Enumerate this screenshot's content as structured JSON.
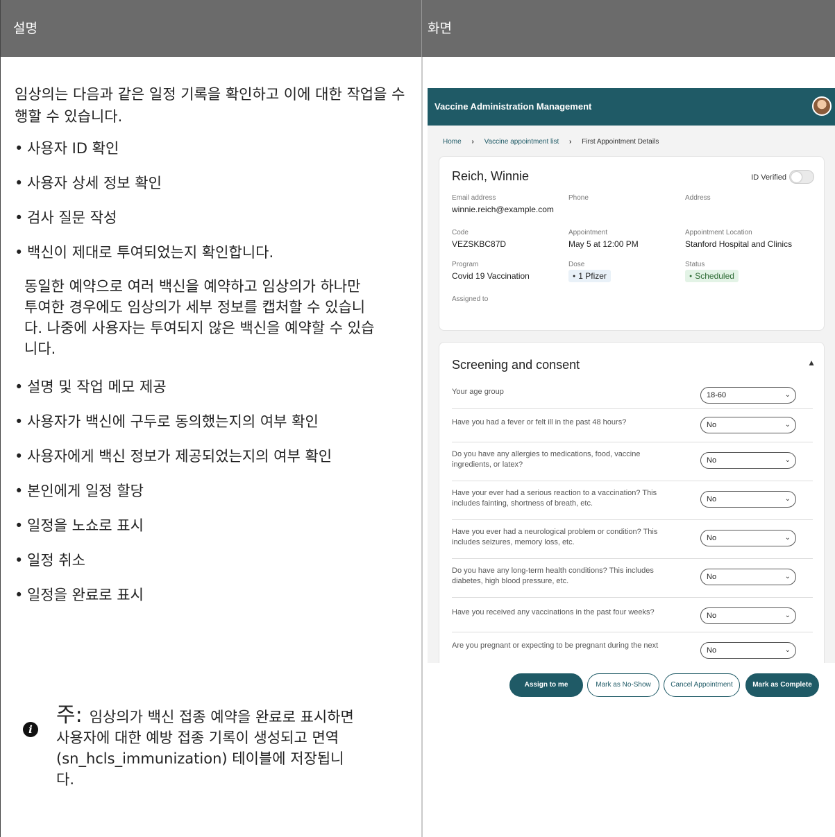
{
  "header": {
    "left": "설명",
    "right": "화면"
  },
  "description": {
    "intro": "임상의는 다음과 같은 일정 기록을 확인하고 이에 대한 작업을 수행할 수 있습니다.",
    "bullets_top": [
      "사용자 ID 확인",
      "사용자 상세 정보 확인",
      "검사 질문 작성",
      "백신이 제대로 투여되었는지 확인합니다."
    ],
    "sub_paragraph": "동일한 예약으로 여러 백신을 예약하고 임상의가 하나만 투여한 경우에도 임상의가 세부 정보를 캡처할 수 있습니다. 나중에 사용자는 투여되지 않은 백신을 예약할 수 있습니다.",
    "bullets_bottom": [
      "설명 및 작업 메모 제공",
      "사용자가 백신에 구두로 동의했는지의 여부 확인",
      "사용자에게 백신 정보가 제공되었는지의 여부 확인",
      "본인에게 일정 할당",
      "일정을 노쇼로 표시",
      "일정 취소",
      "일정을 완료로 표시"
    ],
    "note_heading": "주:",
    "note_text": "임상의가 백신 접종 예약을 완료로 표시하면 사용자에 대한 예방 접종 기록이 생성되고 면역 (sn_hcls_immunization) 테이블에 저장됩니다."
  },
  "app": {
    "title": "Vaccine Administration Management",
    "breadcrumb": [
      "Home",
      "Vaccine appointment list",
      "First Appointment Details"
    ],
    "patient_name": "Reich, Winnie",
    "id_verified_label": "ID Verified",
    "id_verified": false,
    "fields": {
      "email_label": "Email address",
      "email": "winnie.reich@example.com",
      "phone_label": "Phone",
      "phone": "",
      "address_label": "Address",
      "address": "",
      "code_label": "Code",
      "code": "VEZSKBC87D",
      "appointment_label": "Appointment",
      "appointment": "May 5 at 12:00 PM",
      "location_label": "Appointment Location",
      "location": "Stanford Hospital and Clinics",
      "program_label": "Program",
      "program": "Covid 19 Vaccination",
      "dose_label": "Dose",
      "dose": "1 Pfizer",
      "status_label": "Status",
      "status": "Scheduled",
      "assigned_label": "Assigned to",
      "assigned": ""
    },
    "screening": {
      "title": "Screening and consent",
      "questions": [
        {
          "text": "Your age group",
          "answer": "18-60"
        },
        {
          "text": "Have you had a fever or felt ill in the past 48 hours?",
          "answer": "No"
        },
        {
          "text": "Do you have any allergies to medications, food, vaccine ingredients, or latex?",
          "answer": "No"
        },
        {
          "text": "Have your ever had a serious reaction to a vaccination? This includes fainting, shortness of breath, etc.",
          "answer": "No"
        },
        {
          "text": "Have you ever had a neurological problem or condition? This includes seizures, memory loss, etc.",
          "answer": "No"
        },
        {
          "text": "Do you have any long-term health conditions? This includes diabetes, high blood pressure, etc.",
          "answer": "No"
        },
        {
          "text": "Have you received any vaccinations in the past four weeks?",
          "answer": "No"
        },
        {
          "text": "Are you pregnant or expecting to be pregnant during the next",
          "answer": "No"
        }
      ]
    },
    "actions": {
      "assign": "Assign to me",
      "no_show": "Mark as No-Show",
      "cancel": "Cancel Appointment",
      "complete": "Mark as Complete"
    }
  }
}
